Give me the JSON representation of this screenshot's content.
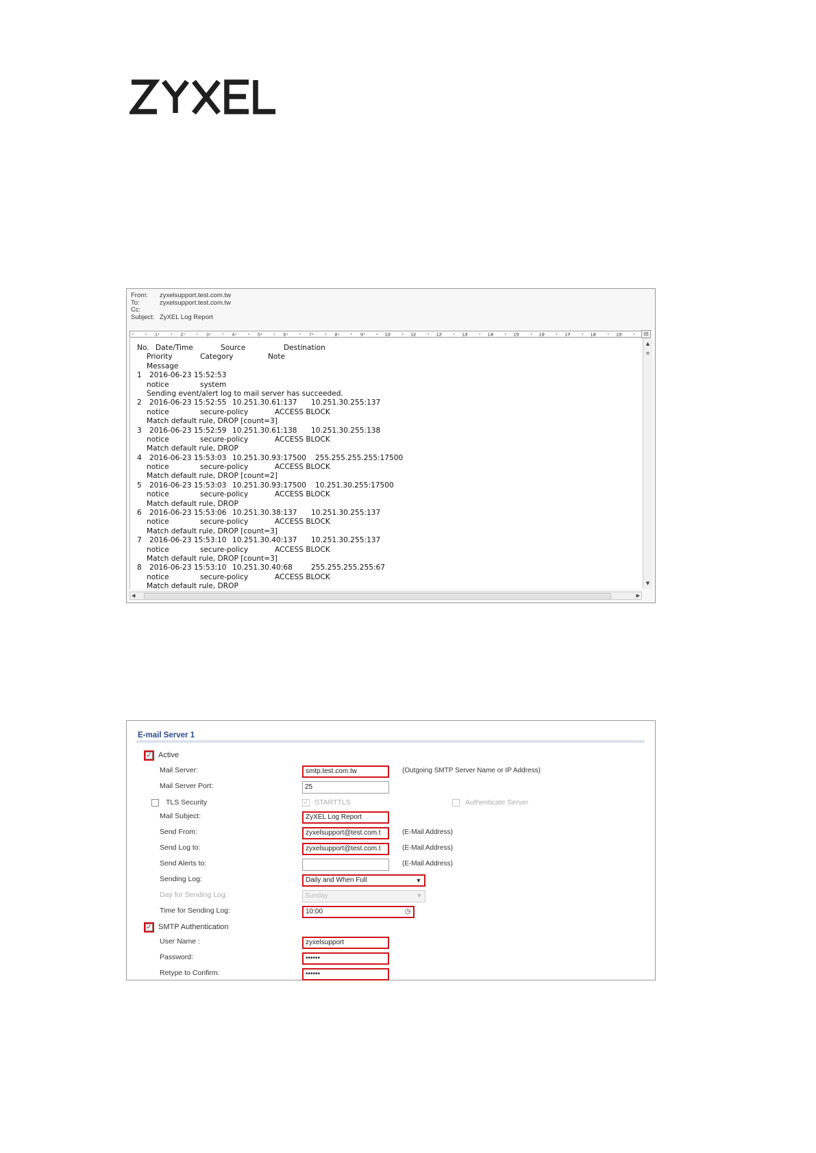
{
  "logo": {
    "text": "ZYXEL"
  },
  "email": {
    "header": [
      {
        "label": "From:",
        "value": "zyxelsupport.test.com.tw"
      },
      {
        "label": "To:",
        "value": "zyxelsupport.test.com.tw"
      },
      {
        "label": "Cc:",
        "value": ""
      },
      {
        "label": "Subject:",
        "value": "ZyXEL Log Report"
      }
    ],
    "ruler_numbers": [
      "1",
      "2",
      "3",
      "4",
      "5",
      "6",
      "7",
      "8",
      "9",
      "10",
      "11",
      "12",
      "13",
      "14",
      "15",
      "16",
      "17",
      "18",
      "19"
    ],
    "columns": {
      "no": "No.",
      "datetime": "Date/Time",
      "source": "Source",
      "destination": "Destination",
      "priority": "Priority",
      "category": "Category",
      "note": "Note",
      "message": "Message"
    },
    "entries": [
      {
        "no": "1",
        "datetime": "2016-06-23 15:52:53",
        "source": "",
        "destination": "",
        "priority": "notice",
        "category": "system",
        "note": "",
        "message": "Sending event/alert log to mail server has succeeded."
      },
      {
        "no": "2",
        "datetime": "2016-06-23 15:52:55",
        "source": "10.251.30.61:137",
        "destination": "10.251.30.255:137",
        "priority": "notice",
        "category": "secure-policy",
        "note": "ACCESS BLOCK",
        "message": "Match default rule, DROP [count=3]"
      },
      {
        "no": "3",
        "datetime": "2016-06-23 15:52:59",
        "source": "10.251.30.61:138",
        "destination": "10.251.30.255:138",
        "priority": "notice",
        "category": "secure-policy",
        "note": "ACCESS BLOCK",
        "message": "Match default rule, DROP"
      },
      {
        "no": "4",
        "datetime": "2016-06-23 15:53:03",
        "source": "10.251.30.93:17500",
        "destination": "255.255.255.255:17500",
        "priority": "notice",
        "category": "secure-policy",
        "note": "ACCESS BLOCK",
        "message": "Match default rule, DROP [count=2]"
      },
      {
        "no": "5",
        "datetime": "2016-06-23 15:53:03",
        "source": "10.251.30.93:17500",
        "destination": "10.251.30.255:17500",
        "priority": "notice",
        "category": "secure-policy",
        "note": "ACCESS BLOCK",
        "message": "Match default rule, DROP"
      },
      {
        "no": "6",
        "datetime": "2016-06-23 15:53:06",
        "source": "10.251.30.38:137",
        "destination": "10.251.30.255:137",
        "priority": "notice",
        "category": "secure-policy",
        "note": "ACCESS BLOCK",
        "message": "Match default rule, DROP [count=3]"
      },
      {
        "no": "7",
        "datetime": "2016-06-23 15:53:10",
        "source": "10.251.30.40:137",
        "destination": "10.251.30.255:137",
        "priority": "notice",
        "category": "secure-policy",
        "note": "ACCESS BLOCK",
        "message": "Match default rule, DROP [count=3]"
      },
      {
        "no": "8",
        "datetime": "2016-06-23 15:53:10",
        "source": "10.251.30.40:68",
        "destination": "255.255.255.255:67",
        "priority": "notice",
        "category": "secure-policy",
        "note": "ACCESS BLOCK",
        "message": "Match default rule, DROP"
      }
    ]
  },
  "server_panel": {
    "title": "E-mail Server 1",
    "active": {
      "label": "Active",
      "checked": true
    },
    "mail_server": {
      "label": "Mail Server:",
      "value": "smtp.test.com.tw",
      "hint": "(Outgoing SMTP Server Name or IP Address)"
    },
    "mail_server_port": {
      "label": "Mail Server Port:",
      "value": "25"
    },
    "tls_security": {
      "label": "TLS Security",
      "checked": false
    },
    "starttls": {
      "label": "STARTTLS",
      "checked": true
    },
    "authenticate_server": {
      "label": "Authenticate Server",
      "checked": false
    },
    "mail_subject": {
      "label": "Mail Subject:",
      "value": "ZyXEL Log Report"
    },
    "send_from": {
      "label": "Send From:",
      "value": "zyxelsupport@test.com.t",
      "hint": "(E-Mail Address)"
    },
    "send_log_to": {
      "label": "Send Log to:",
      "value": "zyxelsupport@test.com.t",
      "hint": "(E-Mail Address)"
    },
    "send_alerts_to": {
      "label": "Send Alerts to:",
      "value": "",
      "hint": "(E-Mail Address)"
    },
    "sending_log": {
      "label": "Sending Log:",
      "value": "Daily and When Full"
    },
    "day_for_sending_log": {
      "label": "Day for Sending Log:",
      "value": "Sunday"
    },
    "time_for_sending_log": {
      "label": "Time for Sending Log:",
      "value": "10:00"
    },
    "smtp_auth": {
      "label": "SMTP Authentication",
      "checked": true
    },
    "user_name": {
      "label": "User Name :",
      "value": "zyxelsupport"
    },
    "password": {
      "label": "Password:",
      "value": "••••••"
    },
    "retype": {
      "label": "Retype to Confirm:",
      "value": "••••••"
    },
    "colors": {
      "highlight": "#d0131b",
      "title": "#2b4a8c"
    }
  }
}
